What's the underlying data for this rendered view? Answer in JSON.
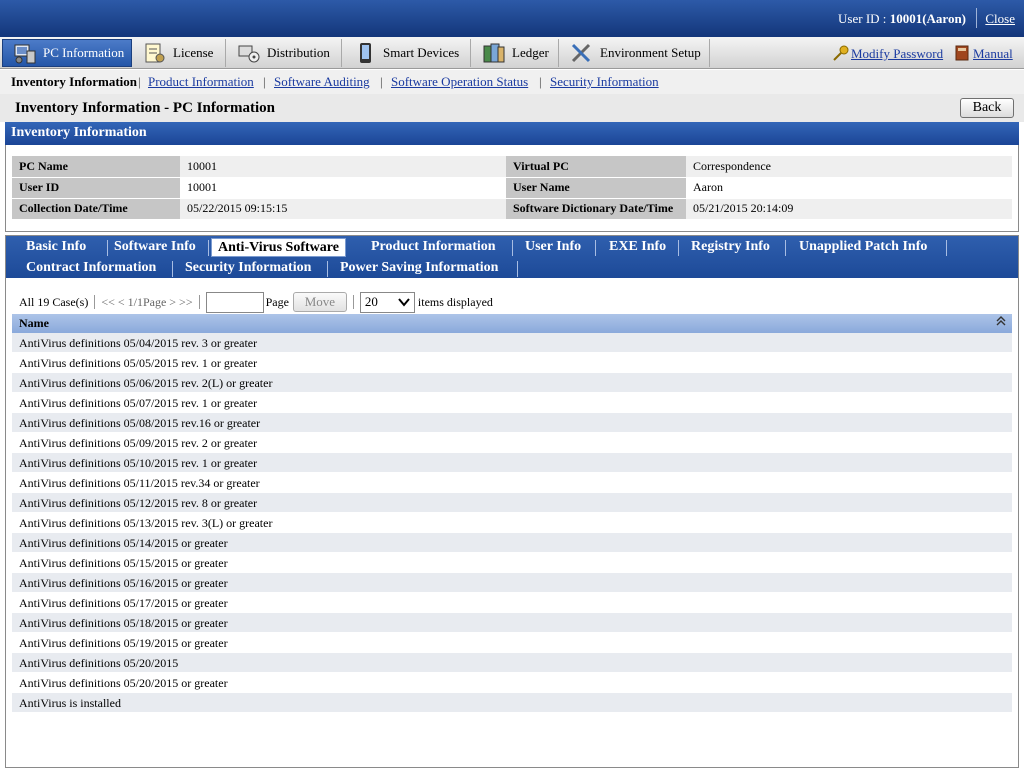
{
  "header": {
    "user_label": "User ID : ",
    "user_value": "10001(Aaron)",
    "close_label": "Close"
  },
  "menu": {
    "items": [
      {
        "label": "PC Information",
        "icon": "pc-icon"
      },
      {
        "label": "License",
        "icon": "license-icon"
      },
      {
        "label": "Distribution",
        "icon": "distribution-icon"
      },
      {
        "label": "Smart Devices",
        "icon": "smart-device-icon"
      },
      {
        "label": "Ledger",
        "icon": "ledger-icon"
      },
      {
        "label": "Environment Setup",
        "icon": "tools-icon"
      }
    ],
    "modify_password": "Modify Password",
    "manual": "Manual"
  },
  "subnav": {
    "current": "Inventory Information",
    "links": [
      "Product Information",
      "Software Auditing",
      "Software Operation Status",
      "Security Information"
    ]
  },
  "page": {
    "title": "Inventory Information - PC Information",
    "back_label": "Back"
  },
  "inventory": {
    "title": "Inventory Information",
    "rows": [
      {
        "l1": "PC Name",
        "v1": "10001",
        "l2": "Virtual PC",
        "v2": "Correspondence"
      },
      {
        "l1": "User ID",
        "v1": "10001",
        "l2": "User Name",
        "v2": "Aaron"
      },
      {
        "l1": "Collection Date/Time",
        "v1": "05/22/2015 09:15:15",
        "l2": "Software Dictionary Date/Time",
        "v2": "05/21/2015 20:14:09"
      }
    ]
  },
  "tabs": {
    "row1": [
      "Basic Info",
      "Software Info",
      "Anti-Virus Software",
      "Product Information",
      "User Info",
      "EXE Info",
      "Registry Info",
      "Unapplied Patch Info"
    ],
    "row2": [
      "Contract Information",
      "Security Information",
      "Power Saving Information"
    ],
    "active": "Anti-Virus Software"
  },
  "pager": {
    "total": "All 19 Case(s)",
    "nav": "<< < 1/1Page > >>",
    "page_input_value": "",
    "page_label": "Page",
    "move_label": "Move",
    "per_page": "20",
    "items_label": "items displayed"
  },
  "list": {
    "column": "Name",
    "rows": [
      "AntiVirus definitions 05/04/2015 rev. 3 or greater",
      "AntiVirus definitions 05/05/2015 rev. 1 or greater",
      "AntiVirus definitions 05/06/2015 rev. 2(L) or greater",
      "AntiVirus definitions 05/07/2015 rev. 1 or greater",
      "AntiVirus definitions 05/08/2015 rev.16 or greater",
      "AntiVirus definitions 05/09/2015 rev. 2 or greater",
      "AntiVirus definitions 05/10/2015 rev. 1 or greater",
      "AntiVirus definitions 05/11/2015 rev.34 or greater",
      "AntiVirus definitions 05/12/2015 rev. 8 or greater",
      "AntiVirus definitions 05/13/2015 rev. 3(L) or greater",
      "AntiVirus definitions 05/14/2015 or greater",
      "AntiVirus definitions 05/15/2015 or greater",
      "AntiVirus definitions 05/16/2015 or greater",
      "AntiVirus definitions 05/17/2015 or greater",
      "AntiVirus definitions 05/18/2015 or greater",
      "AntiVirus definitions 05/19/2015 or greater",
      "AntiVirus definitions 05/20/2015",
      "AntiVirus definitions 05/20/2015 or greater",
      "AntiVirus is installed"
    ]
  }
}
